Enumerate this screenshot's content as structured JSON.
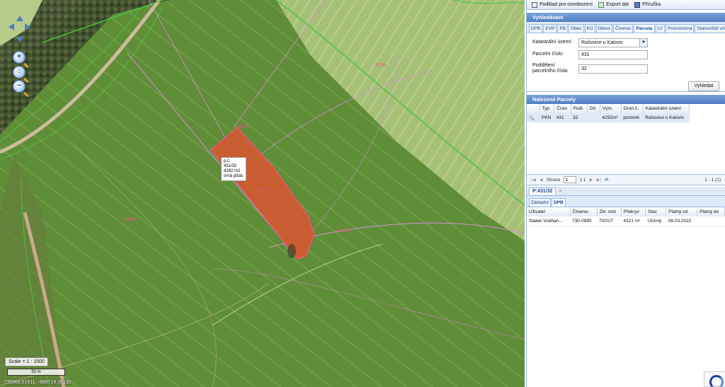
{
  "map": {
    "popup": {
      "line1": "p.č. 431/32",
      "line2": "4292 m2",
      "line3": "orná půda"
    },
    "scale_text": "Scale = 1 : 1500",
    "scalebar_text": "50 m",
    "coords": "-735966.51611, -989719.35130",
    "parcel_labels": {
      "main": "431/32",
      "left": "431/8",
      "right": "431/31",
      "top": "431/3",
      "upper": "4293"
    },
    "colors": {
      "field": "#5c8a36",
      "parcel_fill": "#d9552f",
      "parcel_stroke": "#e8587a",
      "boundary_green": "#4ec43a",
      "track": "#b9a98a"
    }
  },
  "toolbar": {
    "podklad_label": "Podklad pro osvobození",
    "export_label": "Export dat",
    "prirucka_label": "Příručka"
  },
  "search": {
    "title": "Vyhledávání",
    "tabs": [
      "DPB",
      "EVP",
      "PB",
      "Obec",
      "KÚ",
      "Okres",
      "Čtverec",
      "Parcela",
      "LV",
      "Provozovna",
      "Stanoviště včel"
    ],
    "active_tab": "Parcela",
    "katastralni_label": "Katastrální území:",
    "katastralni_value": "Rašovice u Kalovic",
    "parcelni_label": "Parcelní číslo:",
    "parcelni_value": "431",
    "podd_label1": "Poddělení",
    "podd_label2": "parcelního čísla:",
    "podd_value": "32",
    "button": "Vyhledat"
  },
  "results": {
    "title": "Nalezené Parcely",
    "columns": [
      "Typ",
      "Číslo",
      "Podl.",
      "Díl.",
      "Vým.",
      "Druh.č.",
      "Katastrální území"
    ],
    "rows": [
      {
        "typ": "PKN",
        "cislo": "431",
        "podl": "32",
        "dil": "",
        "vym": "4292m²",
        "druh": "pozemk",
        "ku": "Rašovice u Kalovic"
      }
    ],
    "pager": {
      "strana": "Strana",
      "page": "1",
      "of": "z 1",
      "count": "1 - 1 (1)"
    }
  },
  "detail": {
    "title": "P:431/32",
    "tabs": [
      "Základní",
      "DPB"
    ],
    "active_tab": "DPB",
    "columns": [
      "Uživatel",
      "Čtverec",
      "Zkr. kód",
      "Překryv",
      "Stav",
      "Platný od",
      "Platný do"
    ],
    "rows": [
      {
        "uzivatel": "Statek Vodňan...",
        "ctverec": "730-0990",
        "kod": "7001/7",
        "prekryv": "4321 m²",
        "stav": "Účinný",
        "od": "08.03.2022",
        "do": ""
      }
    ]
  }
}
